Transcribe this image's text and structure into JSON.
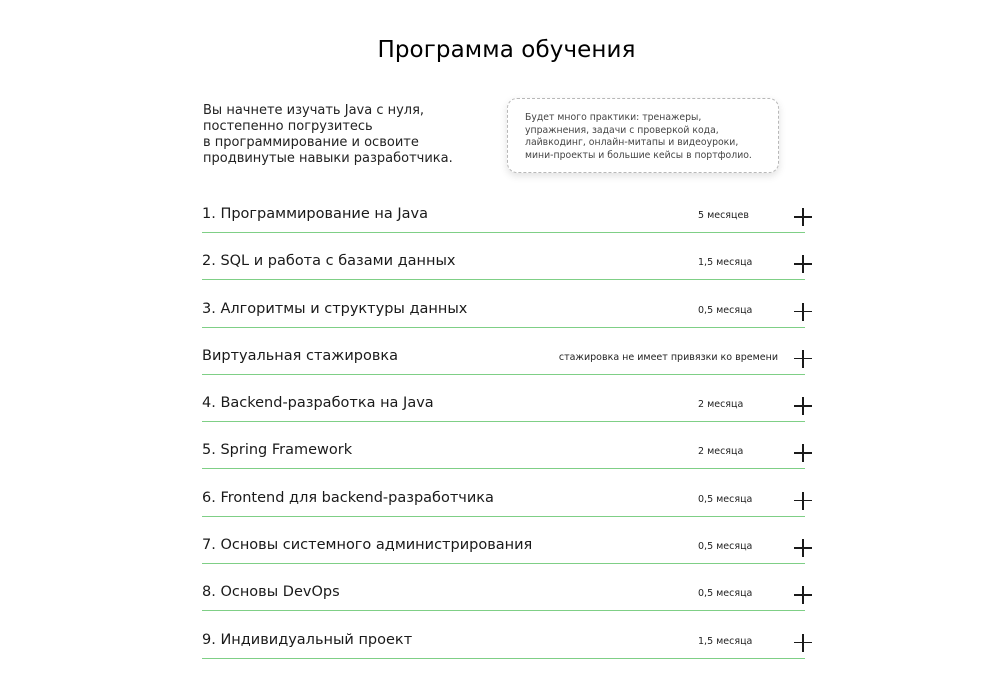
{
  "header": {
    "title": "Программа обучения"
  },
  "intro": {
    "text": "Вы начнете изучать Java с нуля,\nпостепенно погрузитесь\nв программирование и освоите\nпродвинутые навыки разработчика."
  },
  "practice_note": {
    "text": "Будет много практики: тренажеры,\nупражнения, задачи с проверкой кода,\nлайвкодинг, онлайн-митапы и видеоуроки,\nмини-проекты и большие кейсы в портфолио."
  },
  "modules": [
    {
      "title": "1. Программирование на Java",
      "duration": "5 месяцев"
    },
    {
      "title": "2. SQL и работа с базами данных",
      "duration": "1,5 месяца"
    },
    {
      "title": "3. Алгоритмы и структуры данных",
      "duration": "0,5 месяца"
    },
    {
      "title": "Виртуальная стажировка",
      "duration": "стажировка не имеет привязки ко времени"
    },
    {
      "title": "4. Backend-разработка на Java",
      "duration": "2 месяца"
    },
    {
      "title": "5. Spring Framework",
      "duration": "2 месяца"
    },
    {
      "title": "6. Frontend для backend-разработчика",
      "duration": "0,5 месяца"
    },
    {
      "title": "7. Основы системного администрирования",
      "duration": "0,5 месяца"
    },
    {
      "title": "8. Основы DevOps",
      "duration": "0,5 месяца"
    },
    {
      "title": "9. Индивидуальный проект",
      "duration": "1,5 месяца"
    }
  ],
  "icons": {
    "expand": "plus-icon"
  },
  "colors": {
    "divider": "#7fcf86",
    "text": "#1a1a1a",
    "background": "#ffffff"
  }
}
